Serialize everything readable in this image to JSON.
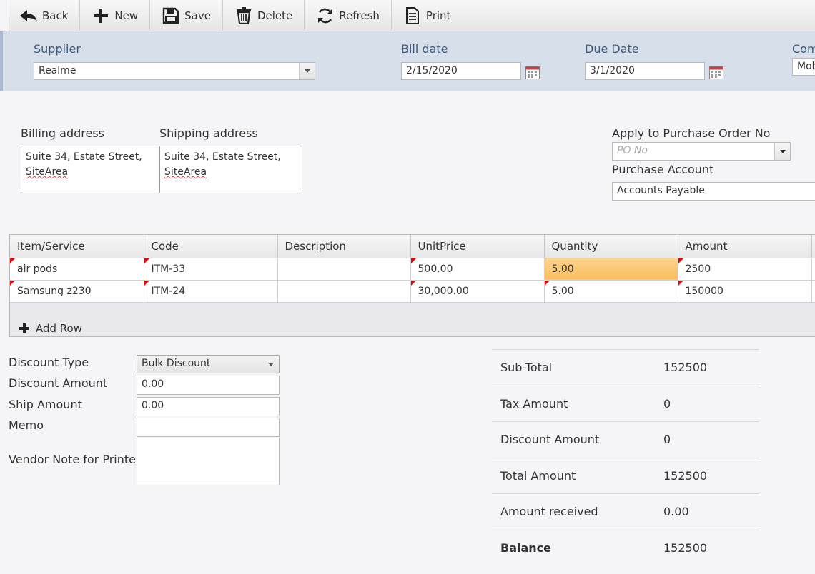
{
  "toolbar": {
    "back": "Back",
    "new": "New",
    "save": "Save",
    "delete": "Delete",
    "refresh": "Refresh",
    "print": "Print"
  },
  "header": {
    "supplier_label": "Supplier",
    "supplier_value": "Realme",
    "bill_date_label": "Bill date",
    "bill_date_value": "2/15/2020",
    "due_date_label": "Due Date",
    "due_date_value": "3/1/2020",
    "com_label": "Com",
    "com_value": "Mob"
  },
  "addresses": {
    "billing_label": "Billing address",
    "billing_line1": "Suite 34, Estate Street,",
    "billing_line2": "SiteArea",
    "shipping_label": "Shipping address",
    "shipping_line1": "Suite 34, Estate Street,",
    "shipping_line2": "SiteArea"
  },
  "po": {
    "label": "Apply to Purchase Order No",
    "placeholder": "PO No",
    "account_label": "Purchase Account",
    "account_value": "Accounts Payable"
  },
  "grid": {
    "columns": [
      "Item/Service",
      "Code",
      "Description",
      "UnitPrice",
      "Quantity",
      "Amount"
    ],
    "rows": [
      [
        "air pods",
        "ITM-33",
        "",
        "500.00",
        "5.00",
        "2500"
      ],
      [
        "Samsung z230",
        "ITM-24",
        "",
        "30,000.00",
        "5.00",
        "150000"
      ]
    ],
    "add_row": "Add Row"
  },
  "form": {
    "discount_type_label": "Discount Type",
    "discount_type_value": "Bulk Discount",
    "discount_amount_label": "Discount Amount",
    "discount_amount_value": "0.00",
    "ship_amount_label": "Ship Amount",
    "ship_amount_value": "0.00",
    "memo_label": "Memo",
    "memo_value": "",
    "vendor_note_label": "Vendor Note for Printer",
    "vendor_note_value": ""
  },
  "totals": {
    "subtotal_label": "Sub-Total",
    "subtotal_value": "152500",
    "tax_label": "Tax Amount",
    "tax_value": "0",
    "discount_label": "Discount Amount",
    "discount_value": "0",
    "total_label": "Total Amount",
    "total_value": "152500",
    "received_label": "Amount received",
    "received_value": "0.00",
    "balance_label": "Balance",
    "balance_value": "152500"
  },
  "colors": {
    "header_band": "#d7dfea",
    "label_blue": "#3e5a82",
    "highlight_cell": "#fbc66c",
    "required_flag": "#e00000"
  }
}
